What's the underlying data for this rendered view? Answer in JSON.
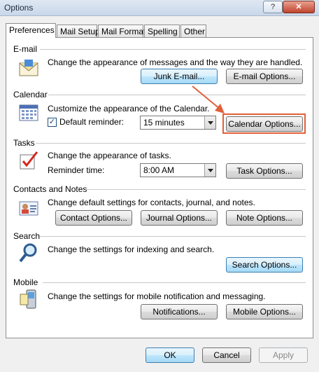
{
  "window": {
    "title": "Options",
    "help": "?",
    "close": "✕"
  },
  "tabs": [
    "Preferences",
    "Mail Setup",
    "Mail Format",
    "Spelling",
    "Other"
  ],
  "email": {
    "label": "E-mail",
    "description": "Change the appearance of messages and the way they are handled.",
    "junk_button": "Junk E-mail...",
    "options_button": "E-mail Options..."
  },
  "calendar": {
    "label": "Calendar",
    "description": "Customize the appearance of the Calendar.",
    "reminder_checkbox": "Default reminder:",
    "reminder_checked": true,
    "reminder_value": "15 minutes",
    "options_button": "Calendar Options..."
  },
  "tasks": {
    "label": "Tasks",
    "description": "Change the appearance of tasks.",
    "reminder_label": "Reminder time:",
    "reminder_value": "8:00 AM",
    "options_button": "Task Options..."
  },
  "contacts": {
    "label": "Contacts and Notes",
    "description": "Change default settings for contacts, journal, and notes.",
    "contact_button": "Contact Options...",
    "journal_button": "Journal Options...",
    "note_button": "Note Options..."
  },
  "search": {
    "label": "Search",
    "description": "Change the settings for indexing and search.",
    "options_button": "Search Options..."
  },
  "mobile": {
    "label": "Mobile",
    "description": "Change the settings for mobile notification and messaging.",
    "notifications_button": "Notifications...",
    "options_button": "Mobile Options..."
  },
  "footer": {
    "ok": "OK",
    "cancel": "Cancel",
    "apply": "Apply"
  },
  "colors": {
    "highlight": "#e2603a",
    "arrow": "#e2603a"
  }
}
